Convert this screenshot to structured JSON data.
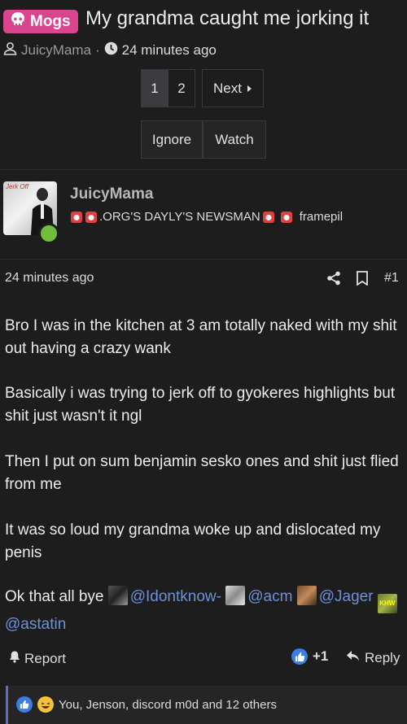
{
  "thread": {
    "prefix": "Mogs",
    "title": "My grandma caught me jorking it",
    "author": "JuicyMama",
    "separator": "·",
    "time": "24 minutes ago"
  },
  "pagination": {
    "pages": [
      "1",
      "2"
    ],
    "current": "1",
    "next_label": "Next"
  },
  "thread_actions": {
    "ignore": "Ignore",
    "watch": "Watch"
  },
  "post": {
    "username": "JuicyMama",
    "user_title": ".ORG'S DAYLY'S NEWSMAN",
    "user_title_tail": "framepil",
    "avatar_text": "Jerk Off",
    "time": "24 minutes ago",
    "number": "#1",
    "paragraphs": [
      "Bro I was in the kitchen at 3 am totally naked with my shit out having a crazy wank",
      "Basically i was trying to jerk off to gyokeres highlights but shit just wasn't it ngl",
      "Then I put on sum benjamin sesko ones and shit just flied from me",
      "It was so loud my grandma woke up and dislocated my penis"
    ],
    "closing_text": "Ok that all bye",
    "mentions": [
      "@Idontknow-",
      "@acm",
      "@Jager",
      "@astatin"
    ],
    "mention_avatar_text": "KHW"
  },
  "footer": {
    "report": "Report",
    "like_count": "+1",
    "reply": "Reply"
  },
  "reactions": {
    "summary": "You, Jenson, discord m0d and 12 others"
  },
  "colors": {
    "background": "#1d1d1e",
    "prefix_badge": "#d9458f",
    "mention": "#6f8fd8",
    "like": "#3b7de0",
    "online": "#6fbf3c"
  }
}
